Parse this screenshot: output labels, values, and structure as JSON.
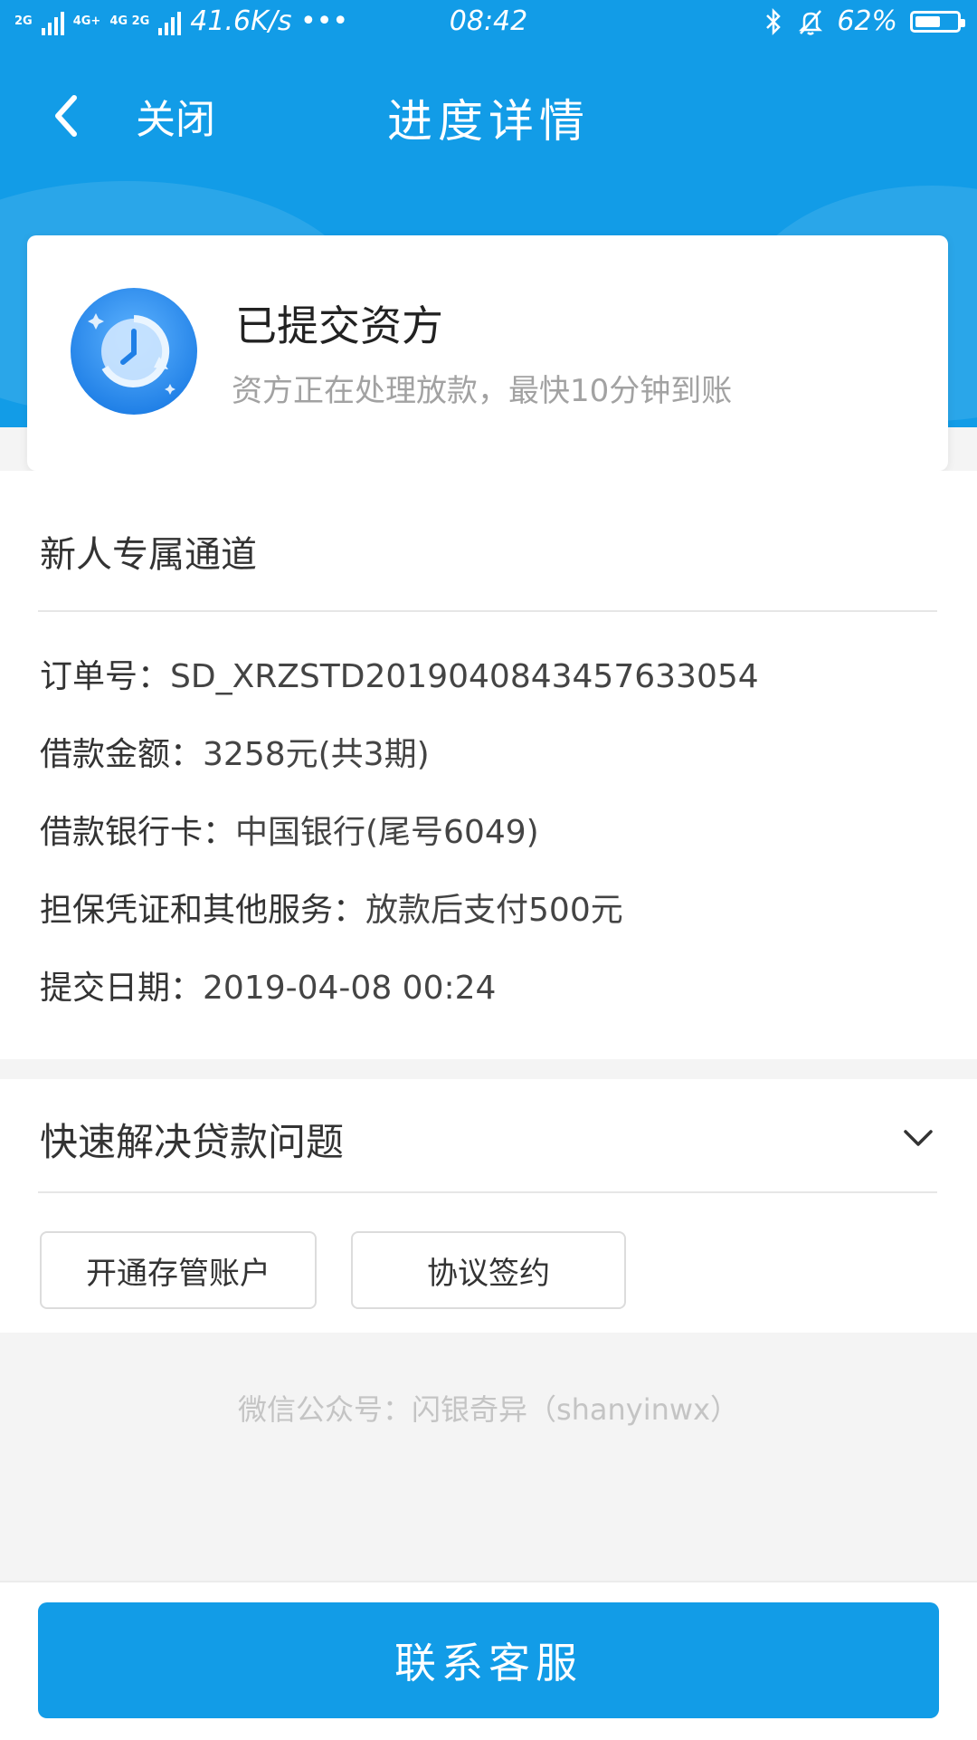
{
  "status_bar": {
    "net_tag_1": "2G",
    "net_tag_2": "4G+",
    "net_tag_3": "4G 2G",
    "speed": "41.6K/s •••",
    "time": "08:42",
    "battery": "62%",
    "battery_level": 0.62
  },
  "nav": {
    "close_label": "关闭",
    "title": "进度详情"
  },
  "status_card": {
    "title": "已提交资方",
    "subtitle": "资方正在处理放款，最快10分钟到账"
  },
  "details": {
    "section_title": "新人专属通道",
    "rows": [
      {
        "label": "订单号：",
        "value": "SD_XRZSTD20190408434576330​54"
      },
      {
        "label": "借款金额：",
        "value": "3258元(共3期)"
      },
      {
        "label": "借款银行卡：",
        "value": "中国银行(尾号6049)"
      },
      {
        "label": "担保凭证和其他服务：",
        "value": "放款后支付500元"
      },
      {
        "label": "提交日期：",
        "value": "2019-04-08 00:24"
      }
    ]
  },
  "quick": {
    "title": "快速解决贷款问题",
    "buttons": [
      "开通存管账户",
      "协议签约"
    ]
  },
  "footer": {
    "wechat_note": "微信公众号：闪银奇异（shanyinwx）",
    "cta_label": "联系客服"
  },
  "colors": {
    "primary": "#129ce7",
    "muted_text": "#a2a2a2"
  }
}
